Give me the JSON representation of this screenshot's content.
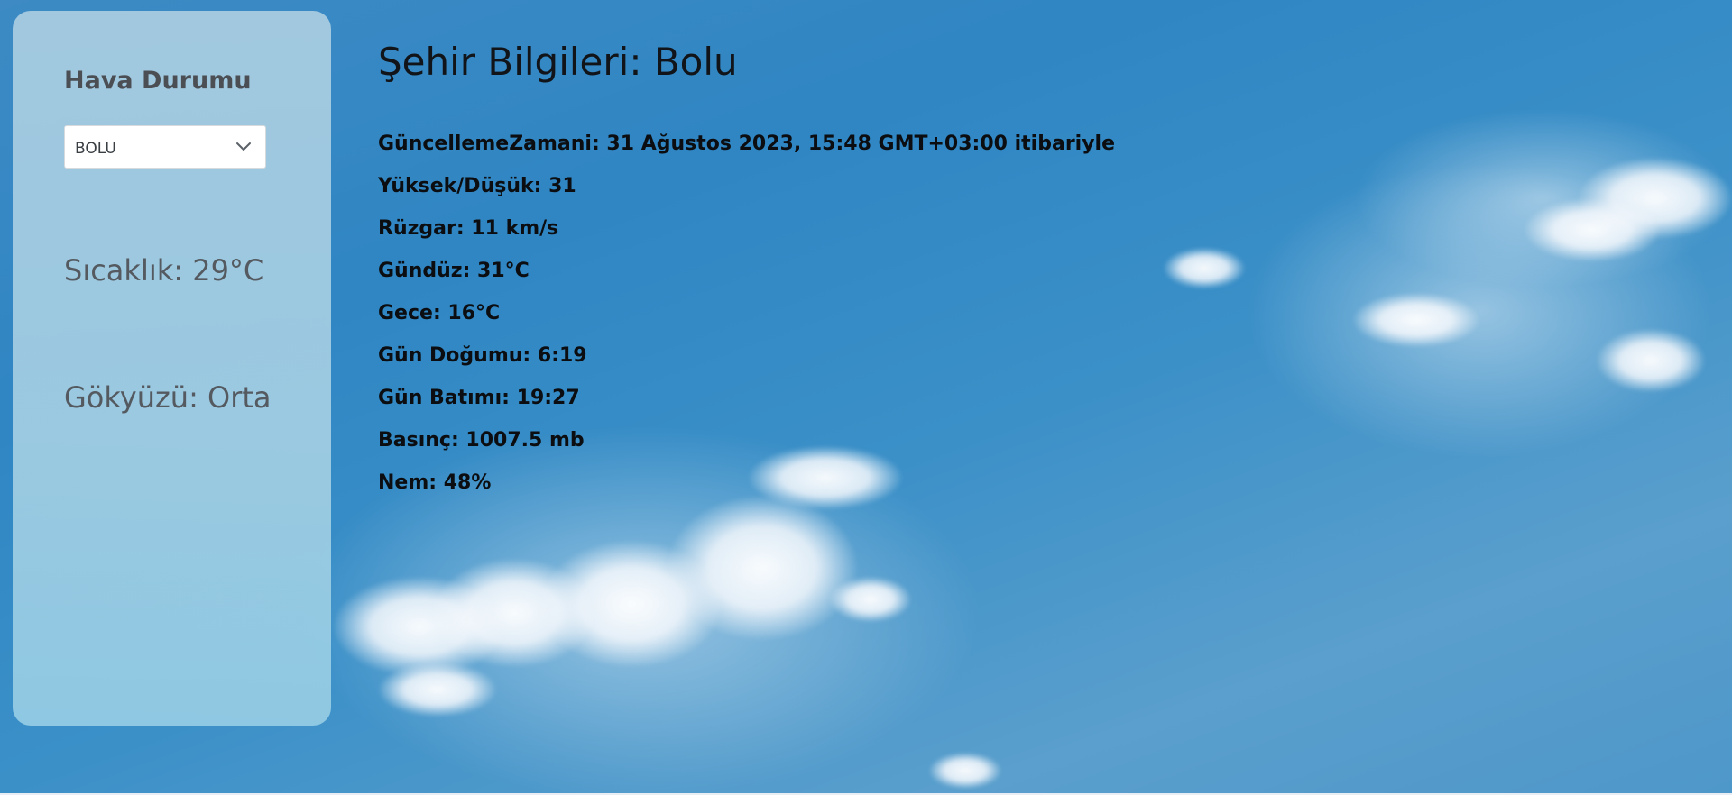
{
  "sidebar": {
    "title": "Hava Durumu",
    "city_select": {
      "value": "BOLU"
    },
    "temperature": "Sıcaklık: 29°C",
    "sky": "Gökyüzü: Orta"
  },
  "main": {
    "title": "Şehir Bilgileri: Bolu",
    "details": [
      "GüncellemeZamani: 31 Ağustos 2023, 15:48 GMT+03:00 itibariyle",
      "Yüksek/Düşük: 31",
      "Rüzgar: 11 km/s",
      "Gündüz: 31°C",
      "Gece: 16°C",
      "Gün Doğumu: 6:19",
      "Gün Batımı: 19:27",
      "Basınç: 1007.5 mb",
      "Nem: 48%"
    ]
  },
  "icons": {
    "select_chevron": "chevron-down-icon"
  },
  "colors": {
    "sky_background": "#2f86c3",
    "sidebar_card": "#a5cfe2",
    "title_text": "#111418"
  }
}
